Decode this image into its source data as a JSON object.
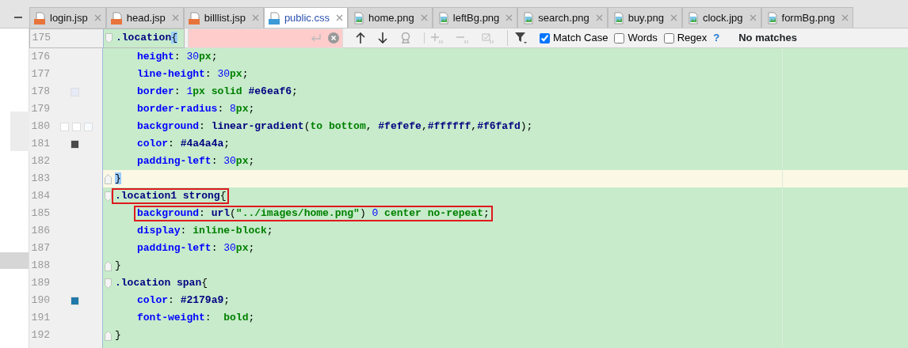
{
  "tabs": [
    {
      "label": "login.jsp",
      "kind": "jsp",
      "selected": false
    },
    {
      "label": "head.jsp",
      "kind": "jsp",
      "selected": false
    },
    {
      "label": "billlist.jsp",
      "kind": "jsp",
      "selected": false
    },
    {
      "label": "public.css",
      "kind": "css",
      "selected": true
    },
    {
      "label": "home.png",
      "kind": "image",
      "selected": false
    },
    {
      "label": "leftBg.png",
      "kind": "image",
      "selected": false
    },
    {
      "label": "search.png",
      "kind": "image",
      "selected": false
    },
    {
      "label": "buy.png",
      "kind": "image",
      "selected": false
    },
    {
      "label": "clock.jpg",
      "kind": "image",
      "selected": false
    },
    {
      "label": "formBg.png",
      "kind": "image",
      "selected": false
    }
  ],
  "search_bar": {
    "match_case": {
      "label": "Match Case",
      "checked": true
    },
    "words": {
      "label": "Words",
      "checked": false
    },
    "regex": {
      "label": "Regex",
      "checked": false
    },
    "help": "?",
    "status": "No matches"
  },
  "lines": [
    {
      "number": "175",
      "kind": "rule-start",
      "code": ".location{",
      "current": false,
      "boxed": false,
      "brace_matched": true
    },
    {
      "number": "176",
      "kind": "declaration",
      "code": "height: 30px;",
      "current": false,
      "boxed": false
    },
    {
      "number": "177",
      "kind": "declaration",
      "code": "line-height: 30px;",
      "current": false,
      "boxed": false
    },
    {
      "number": "178",
      "kind": "declaration",
      "code": "border: 1px solid #e6eaf6;",
      "current": false,
      "boxed": false,
      "swatches": [
        {
          "color": "#e6eaf6"
        }
      ]
    },
    {
      "number": "179",
      "kind": "declaration",
      "code": "border-radius: 8px;",
      "current": false,
      "boxed": false
    },
    {
      "number": "180",
      "kind": "declaration",
      "code": "background: linear-gradient(to bottom, #fefefe,#ffffff,#f6fafd);",
      "current": false,
      "boxed": false,
      "swatches": [
        {
          "color": "#fefefe"
        },
        {
          "color": "#ffffff"
        },
        {
          "color": "#f6fafd"
        }
      ]
    },
    {
      "number": "181",
      "kind": "declaration",
      "code": "color: #4a4a4a;",
      "current": false,
      "boxed": false,
      "swatches": [
        {
          "color": "#4a4a4a"
        }
      ]
    },
    {
      "number": "182",
      "kind": "declaration",
      "code": "padding-left: 30px;",
      "current": false,
      "boxed": false
    },
    {
      "number": "183",
      "kind": "rule-end",
      "code": "}",
      "current": true,
      "boxed": false,
      "brace_matched": true
    },
    {
      "number": "184",
      "kind": "rule-start",
      "code": ".location1 strong{",
      "current": false,
      "boxed": true,
      "brace_matched": false
    },
    {
      "number": "185",
      "kind": "declaration",
      "code": "background: url(\"../images/home.png\") 0 center no-repeat;",
      "current": false,
      "boxed": true
    },
    {
      "number": "186",
      "kind": "declaration",
      "code": "display: inline-block;",
      "current": false,
      "boxed": false
    },
    {
      "number": "187",
      "kind": "declaration",
      "code": "padding-left: 30px;",
      "current": false,
      "boxed": false
    },
    {
      "number": "188",
      "kind": "rule-end",
      "code": "}",
      "current": false,
      "boxed": false,
      "brace_matched": false
    },
    {
      "number": "189",
      "kind": "rule-start",
      "code": ".location span{",
      "current": false,
      "boxed": false,
      "brace_matched": false
    },
    {
      "number": "190",
      "kind": "declaration",
      "code": "color: #2179a9;",
      "current": false,
      "boxed": false,
      "swatches": [
        {
          "color": "#2179a9"
        }
      ]
    },
    {
      "number": "191",
      "kind": "declaration",
      "code": "font-weight:  bold;",
      "current": false,
      "boxed": false
    },
    {
      "number": "192",
      "kind": "rule-end",
      "code": "}",
      "current": false,
      "boxed": false,
      "brace_matched": false
    }
  ]
}
